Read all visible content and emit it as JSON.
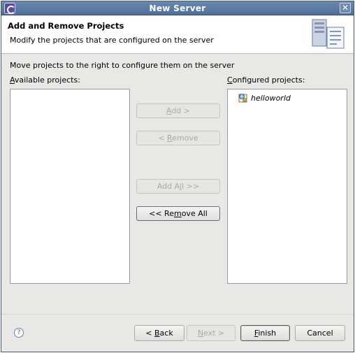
{
  "window": {
    "title": "New Server",
    "close_glyph": "✕"
  },
  "banner": {
    "title": "Add and Remove Projects",
    "description": "Modify the projects that are configured on the server",
    "icon": "server-wizard-icon"
  },
  "instruction": "Move projects to the right to configure them on the server",
  "available": {
    "label_mnemonic": "A",
    "label_rest": "vailable projects:",
    "items": []
  },
  "configured": {
    "label_mnemonic": "C",
    "label_rest": "onfigured projects:",
    "items": [
      {
        "label": "helloworld",
        "icon": "web-project-icon"
      }
    ]
  },
  "buttons": {
    "add": {
      "pre": "",
      "mnemonic": "A",
      "post": "dd >",
      "enabled": false
    },
    "remove": {
      "pre": "< ",
      "mnemonic": "R",
      "post": "emove",
      "enabled": false
    },
    "add_all": {
      "pre": "Add A",
      "mnemonic": "l",
      "post": "l >>",
      "enabled": false
    },
    "remove_all": {
      "pre": "<< Re",
      "mnemonic": "m",
      "post": "ove All",
      "enabled": true
    },
    "back": {
      "pre": "< ",
      "mnemonic": "B",
      "post": "ack",
      "enabled": true
    },
    "next": {
      "pre": "",
      "mnemonic": "N",
      "post": "ext >",
      "enabled": false
    },
    "finish": {
      "pre": "",
      "mnemonic": "F",
      "post": "inish",
      "enabled": true
    },
    "cancel": {
      "label": "Cancel",
      "enabled": true
    }
  },
  "help": {
    "glyph": "?"
  },
  "colors": {
    "titlebar": "#5b7aa3",
    "dialog_bg": "#e8e8e7",
    "disabled_text": "#a8a8a6"
  }
}
